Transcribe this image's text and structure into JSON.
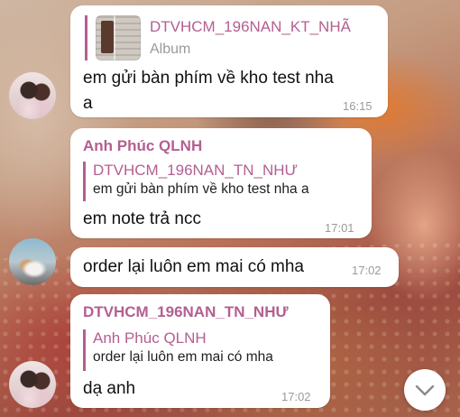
{
  "messages": [
    {
      "quote": {
        "name": "DTVHCM_196NAN_KT_NHÃ",
        "text": "Album"
      },
      "text_lines": [
        "em gửi bàn phím về kho test nha",
        "a"
      ],
      "time": "16:15"
    },
    {
      "sender": "Anh Phúc QLNH",
      "quote": {
        "name": "DTVHCM_196NAN_TN_NHƯ",
        "text": "em gửi bàn phím về kho test nha a"
      },
      "text": "em note trả ncc",
      "time": "17:01"
    },
    {
      "text": "order lại luôn em mai có mha",
      "time": "17:02"
    },
    {
      "sender": "DTVHCM_196NAN_TN_NHƯ",
      "quote": {
        "name": "Anh Phúc QLNH",
        "text": "order lại luôn em mai có mha"
      },
      "text": "dạ anh",
      "time": "17:02"
    }
  ],
  "icons": {
    "scroll_down": "chevron-down-icon",
    "album_thumb": "album-thumbnail",
    "avatars": [
      "avatar-two-girls",
      "avatar-dog",
      "avatar-two-girls"
    ]
  },
  "colors": {
    "accent": "#b35f91",
    "bubble": "#ffffff",
    "time": "#9a9a9a"
  }
}
